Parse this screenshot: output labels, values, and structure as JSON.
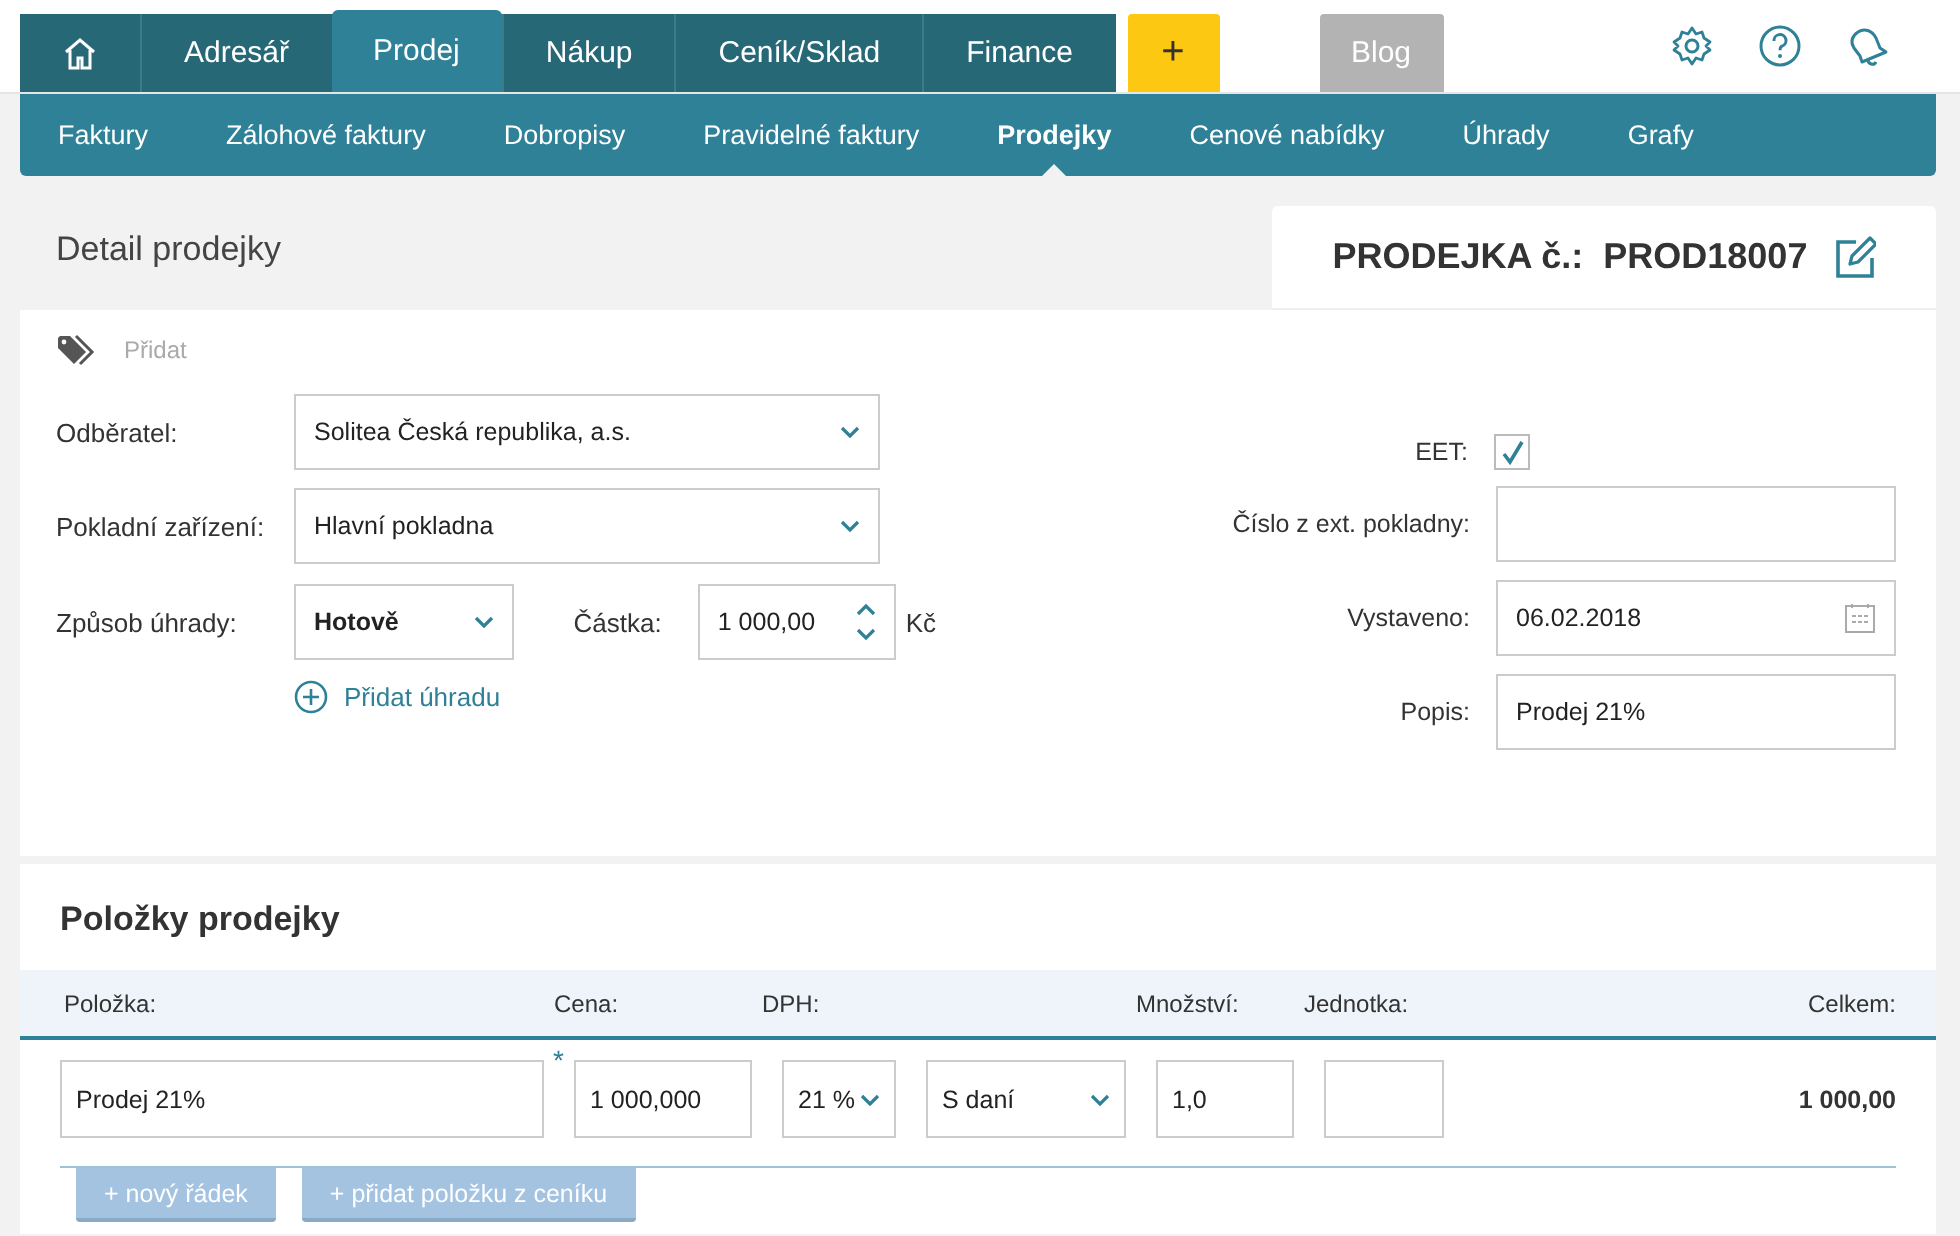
{
  "nav": {
    "tabs": [
      {
        "kind": "home",
        "selected": false
      },
      {
        "kind": "text",
        "label": "Adresář",
        "selected": false
      },
      {
        "kind": "text",
        "label": "Prodej",
        "selected": true
      },
      {
        "kind": "text",
        "label": "Nákup",
        "selected": false
      },
      {
        "kind": "text",
        "label": "Ceník/Sklad",
        "selected": false
      },
      {
        "kind": "text",
        "label": "Finance",
        "selected": false
      }
    ],
    "add_button": "+",
    "blog": "Blog",
    "tools": [
      {
        "kind": "settings"
      },
      {
        "kind": "help"
      },
      {
        "kind": "notifications"
      }
    ]
  },
  "subnav": [
    {
      "label": "Faktury",
      "selected": false
    },
    {
      "label": "Zálohové faktury",
      "selected": false
    },
    {
      "label": "Dobropisy",
      "selected": false
    },
    {
      "label": "Pravidelné faktury",
      "selected": false
    },
    {
      "label": "Prodejky",
      "selected": true
    },
    {
      "label": "Cenové nabídky",
      "selected": false
    },
    {
      "label": "Úhrady",
      "selected": false
    },
    {
      "label": "Grafy",
      "selected": false
    }
  ],
  "page": {
    "title": "Detail prodejky",
    "doc_label": "PRODEJKA č.:",
    "doc_number": "PROD18007"
  },
  "tags": {
    "add_label": "Přidat"
  },
  "form_left": [
    {
      "kind": "select",
      "label": "Odběratel:",
      "value": "Solitea Česká republika, a.s."
    },
    {
      "kind": "select",
      "label": "Pokladní zařízení:",
      "value": "Hlavní pokladna"
    },
    {
      "kind": "payment",
      "label": "Způsob úhrady:",
      "value": "Hotově",
      "amount_label": "Částka:",
      "amount": "1 000,00",
      "currency": "Kč"
    }
  ],
  "add_payment": "Přidat úhradu",
  "form_right": [
    {
      "kind": "checkbox",
      "label": "EET:",
      "checked": true
    },
    {
      "kind": "text",
      "label": "Číslo z ext. pokladny:"
    },
    {
      "kind": "date",
      "label": "Vystaveno:",
      "value": "06.02.2018"
    },
    {
      "kind": "text",
      "label": "Popis:",
      "value": "Prodej 21%"
    }
  ],
  "items": {
    "title": "Položky prodejky",
    "columns": [
      "Položka:",
      "Cena:",
      "DPH:",
      "Množství:",
      "Jednotka:",
      "Celkem:"
    ],
    "rows": [
      {
        "item": "Prodej 21%",
        "required_mark": "*",
        "price": "1 000,000",
        "vat": "21 %",
        "tax_mode": "S daní",
        "quantity": "1,0",
        "total": "1 000,00"
      }
    ],
    "buttons": [
      "+ nový řádek",
      "+ přidat položku z ceníku"
    ]
  }
}
